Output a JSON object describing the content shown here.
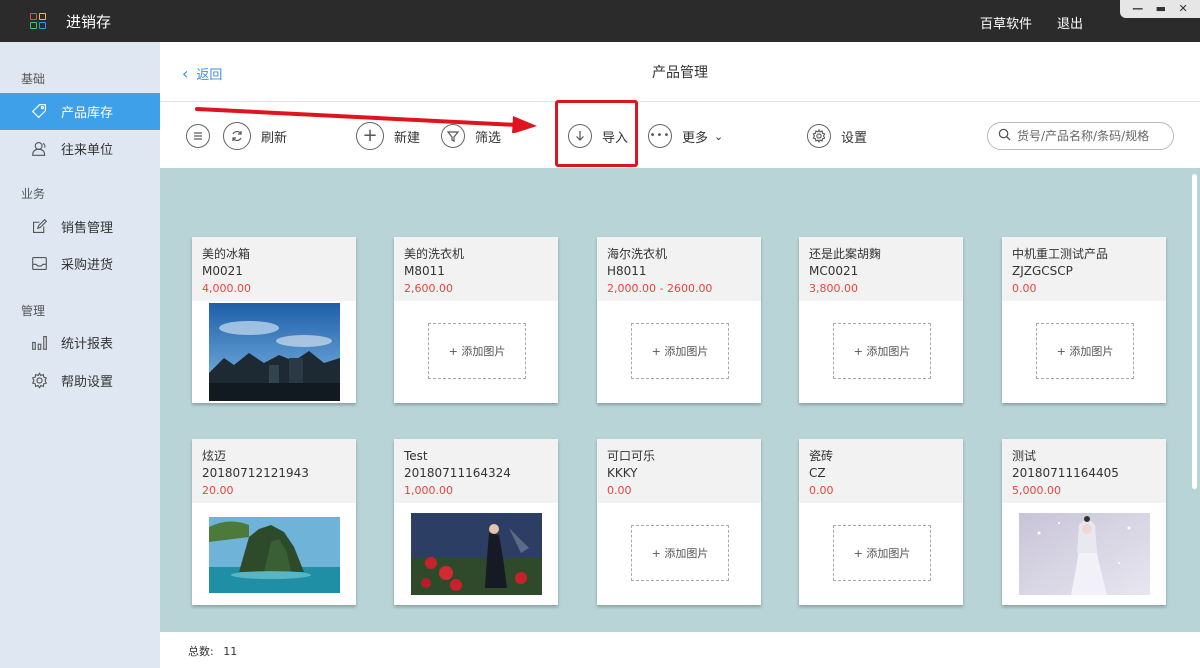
{
  "window": {
    "app_title": "进销存",
    "company_link": "百草软件",
    "logout_link": "退出",
    "minimize": "—",
    "maximize": "▬",
    "close": "✕"
  },
  "sidebar": {
    "sections": [
      {
        "title": "基础",
        "items": [
          {
            "label": "产品库存",
            "icon": "tag-icon",
            "active": true
          },
          {
            "label": "往来单位",
            "icon": "contacts-icon",
            "active": false
          }
        ]
      },
      {
        "title": "业务",
        "items": [
          {
            "label": "销售管理",
            "icon": "edit-icon",
            "active": false
          },
          {
            "label": "采购进货",
            "icon": "inbox-icon",
            "active": false
          }
        ]
      },
      {
        "title": "管理",
        "items": [
          {
            "label": "统计报表",
            "icon": "bar-chart-icon",
            "active": false
          },
          {
            "label": "帮助设置",
            "icon": "gear-icon",
            "active": false
          }
        ]
      }
    ]
  },
  "header": {
    "back_label": "返回",
    "title": "产品管理"
  },
  "toolbar": {
    "refresh_label": "刷新",
    "new_label": "新建",
    "filter_label": "筛选",
    "import_label": "导入",
    "more_label": "更多",
    "settings_label": "设置",
    "search_placeholder": "货号/产品名称/条码/规格"
  },
  "annotation": {
    "highlight_color": "#e0141e"
  },
  "products": [
    {
      "name": "美的冰箱",
      "code": "M0021",
      "price": "4,000.00",
      "image": "sky-city-photo"
    },
    {
      "name": "美的洗衣机",
      "code": "M8011",
      "price": "2,600.00",
      "image": null
    },
    {
      "name": "海尔洗衣机",
      "code": "H8011",
      "price": "2,000.00 - 2600.00",
      "image": null
    },
    {
      "name": "还是此案胡麴",
      "code": "MC0021",
      "price": "3,800.00",
      "image": null
    },
    {
      "name": "中机重工测试产品",
      "code": "ZJZGCSCP",
      "price": "0.00",
      "image": null
    },
    {
      "name": "炫迈",
      "code": "20180712121943",
      "price": "20.00",
      "image": "island-photo"
    },
    {
      "name": "Test",
      "code": "20180711164324",
      "price": "1,000.00",
      "image": "game-character-photo"
    },
    {
      "name": "可口可乐",
      "code": "KKKY",
      "price": "0.00",
      "image": null
    },
    {
      "name": "瓷砖",
      "code": "CZ",
      "price": "0.00",
      "image": null
    },
    {
      "name": "测试",
      "code": "20180711164405",
      "price": "5,000.00",
      "image": "snow-character-photo"
    }
  ],
  "add_image_label": "+ 添加图片",
  "footer": {
    "total_label": "总数:",
    "total_value": "11"
  },
  "colors": {
    "accent": "#3ea0e8",
    "price": "#e8463c",
    "content_bg": "#b8d4d6",
    "sidebar_bg": "#dfe8f2"
  }
}
